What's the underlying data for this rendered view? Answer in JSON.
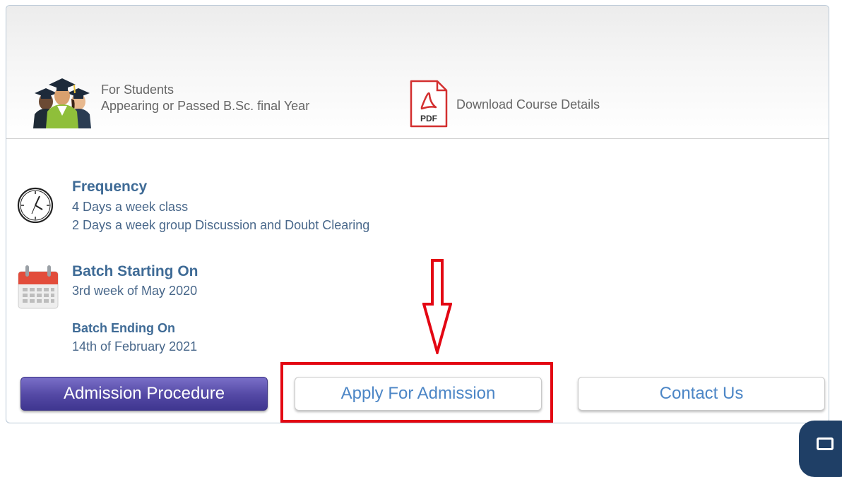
{
  "eligibility": {
    "line1": "For Students",
    "line2": "Appearing or Passed B.Sc. final Year"
  },
  "download": {
    "pdf_label": "PDF",
    "label": "Download Course Details"
  },
  "frequency": {
    "heading": "Frequency",
    "line1": "4 Days a week class",
    "line2": "2 Days a week group Discussion and Doubt Clearing"
  },
  "batch": {
    "start_heading": "Batch Starting On",
    "start_value": "3rd week of May 2020",
    "end_heading": "Batch Ending On",
    "end_value": "14th of February 2021"
  },
  "buttons": {
    "admission_procedure": "Admission Procedure",
    "apply": "Apply For Admission",
    "contact": "Contact Us"
  },
  "colors": {
    "annotation": "#e30613",
    "heading": "#3f6b96",
    "button_primary": "#5348a4",
    "link_text": "#4c86c6"
  },
  "icons": {
    "students": "graduation-students-icon",
    "pdf": "pdf-file-icon",
    "clock": "clock-icon",
    "calendar": "calendar-icon",
    "arrow": "down-arrow-annotation"
  }
}
